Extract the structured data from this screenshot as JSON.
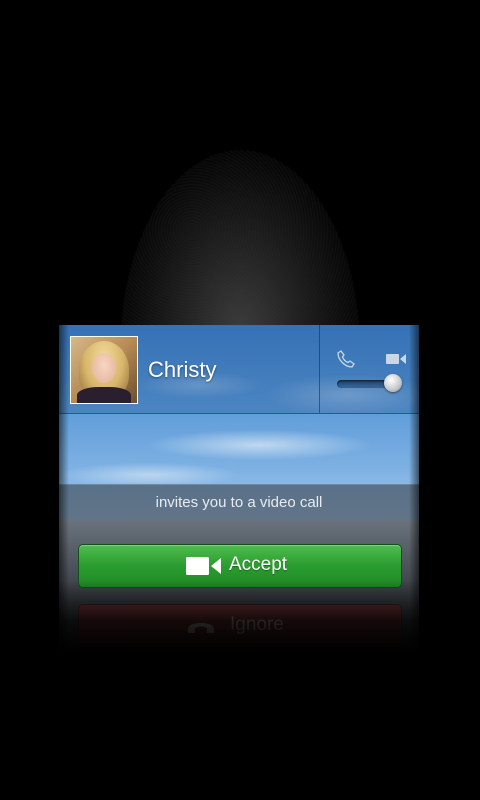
{
  "caller": {
    "name": "Christy",
    "invite_text": "invites you to a video call"
  },
  "call_mode": {
    "options": [
      "phone-icon",
      "video-camera-icon"
    ],
    "selected": "video"
  },
  "actions": {
    "accept_label": "Accept",
    "ignore_label": "Ignore"
  },
  "icons": {
    "phone_mini": "phone-icon",
    "video_mini": "video-camera-icon",
    "accept": "video-camera-icon",
    "ignore": "phone-hangup-icon"
  },
  "colors": {
    "accept_green": "#2b9c2f",
    "ignore_red": "#8a2424",
    "sky_blue": "#5b9ad8"
  }
}
